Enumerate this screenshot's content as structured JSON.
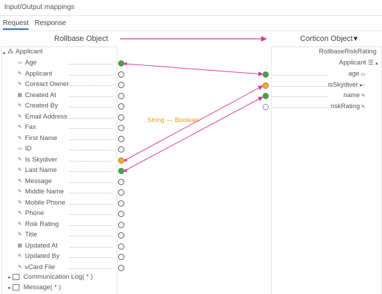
{
  "header": {
    "title": "Input/Output mappings"
  },
  "tabs": [
    {
      "label": "Request"
    },
    {
      "label": "Response"
    }
  ],
  "left_panel": {
    "title": "Rollbase Object",
    "root": "Applicant",
    "fields": [
      {
        "label": "Age",
        "icon": "number-icon",
        "port": "green"
      },
      {
        "label": "Applicant",
        "icon": "text-icon",
        "port": "empty"
      },
      {
        "label": "Contact Owner",
        "icon": "text-icon",
        "port": "empty"
      },
      {
        "label": "Created At",
        "icon": "calendar-icon",
        "port": "empty"
      },
      {
        "label": "Created By",
        "icon": "text-icon",
        "port": "empty"
      },
      {
        "label": "Email Address",
        "icon": "text-icon",
        "port": "empty"
      },
      {
        "label": "Fax",
        "icon": "text-icon",
        "port": "empty"
      },
      {
        "label": "First Name",
        "icon": "text-icon",
        "port": "empty"
      },
      {
        "label": "ID",
        "icon": "number-icon",
        "port": "empty"
      },
      {
        "label": "Is Skydiver",
        "icon": "text-icon",
        "port": "orange"
      },
      {
        "label": "Last Name",
        "icon": "text-icon",
        "port": "green"
      },
      {
        "label": "Message",
        "icon": "text-icon",
        "port": "empty"
      },
      {
        "label": "Middle Name",
        "icon": "text-icon",
        "port": "empty"
      },
      {
        "label": "Mobile Phone",
        "icon": "text-icon",
        "port": "empty"
      },
      {
        "label": "Phone",
        "icon": "text-icon",
        "port": "empty"
      },
      {
        "label": "Risk Rating",
        "icon": "text-icon",
        "port": "empty"
      },
      {
        "label": "Title",
        "icon": "text-icon",
        "port": "empty"
      },
      {
        "label": "Updated At",
        "icon": "calendar-icon",
        "port": "empty"
      },
      {
        "label": "Updated By",
        "icon": "text-icon",
        "port": "empty"
      },
      {
        "label": "vCard File",
        "icon": "text-icon",
        "port": "empty"
      }
    ],
    "relations": [
      {
        "label": "Communication Log( * )"
      },
      {
        "label": "Message( * )"
      }
    ]
  },
  "right_panel": {
    "title": "Corticon Object",
    "root": "RollbaseRiskRating",
    "entity": "Applicant",
    "fields": [
      {
        "label": "age",
        "icon": "number-icon",
        "port": "green"
      },
      {
        "label": "isSkydiver",
        "icon": "toggle-icon",
        "port": "orange"
      },
      {
        "label": "name",
        "icon": "text-icon",
        "port": "green"
      },
      {
        "label": "riskRating",
        "icon": "text-icon",
        "port": "grey"
      }
    ]
  },
  "conversion_label": "String — Boolean",
  "colors": {
    "mapped": "#4f9a4e",
    "converted": "#f0ad3a",
    "link": "#e0399a",
    "header_arrow": "#d6359a",
    "accent": "#2f6fae"
  }
}
